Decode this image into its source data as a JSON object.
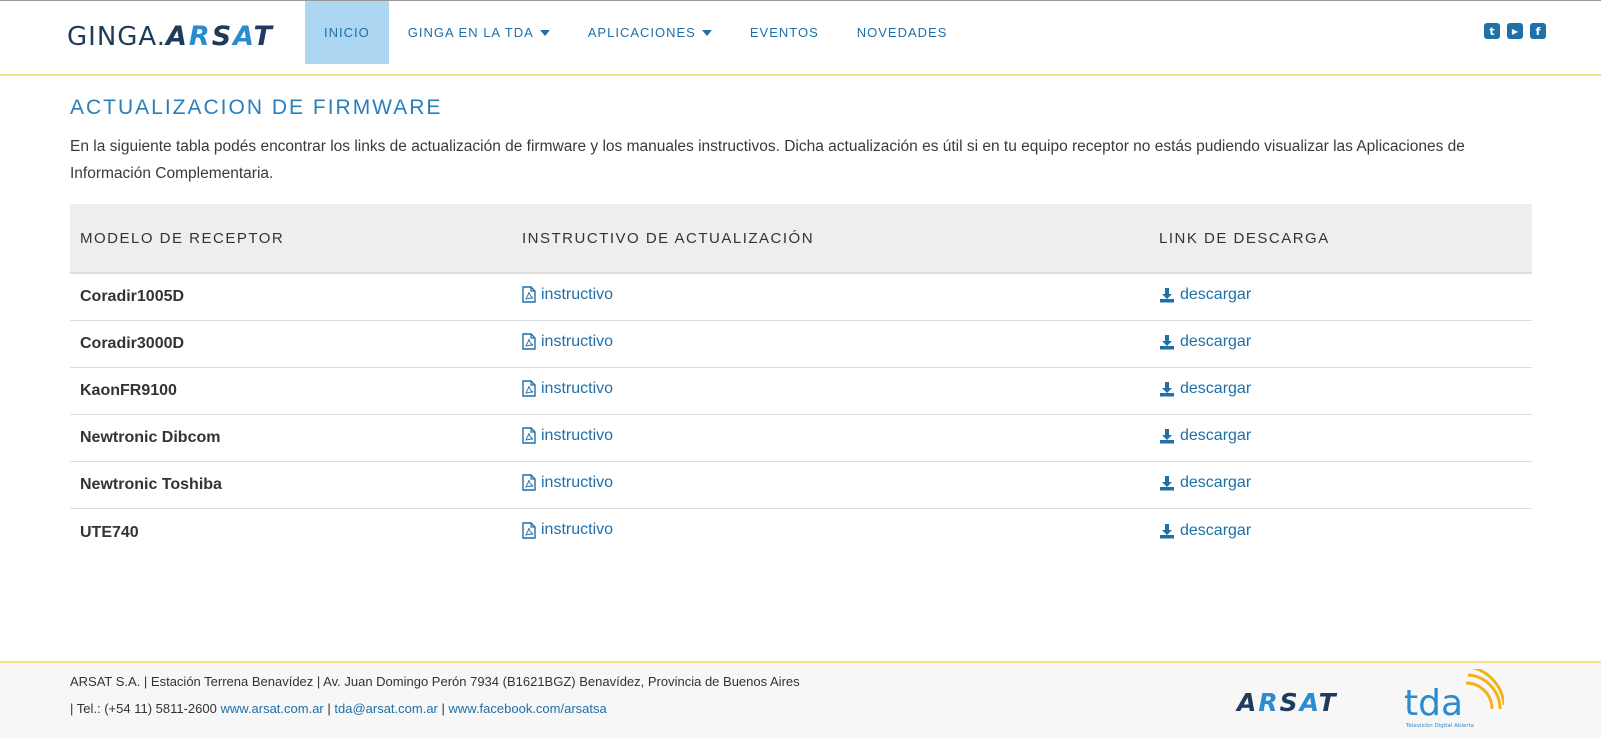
{
  "header": {
    "logo_left": "GINGA.",
    "logo_right": "ARSAT",
    "nav": [
      {
        "label": "INICIO",
        "active": true,
        "dropdown": false
      },
      {
        "label": "GINGA EN LA TDA",
        "active": false,
        "dropdown": true
      },
      {
        "label": "APLICACIONES",
        "active": false,
        "dropdown": true
      },
      {
        "label": "EVENTOS",
        "active": false,
        "dropdown": false
      },
      {
        "label": "NOVEDADES",
        "active": false,
        "dropdown": false
      }
    ],
    "social": [
      {
        "name": "twitter-icon",
        "glyph": "t"
      },
      {
        "name": "youtube-icon",
        "glyph": "▶"
      },
      {
        "name": "facebook-icon",
        "glyph": "f"
      }
    ]
  },
  "main": {
    "title": "ACTUALIZACION DE FIRMWARE",
    "intro": "En la siguiente tabla podés encontrar los links de actualización de firmware y los manuales instructivos. Dicha actualización es útil si en tu equipo receptor no estás pudiendo visualizar las Aplicaciones de Información Complementaria.",
    "table": {
      "headers": [
        "MODELO DE RECEPTOR",
        "INSTRUCTIVO DE ACTUALIZACIÓN",
        "LINK DE DESCARGA"
      ],
      "rows": [
        {
          "model": "Coradir1005D",
          "manual": "instructivo",
          "download": "descargar"
        },
        {
          "model": "Coradir3000D",
          "manual": "instructivo",
          "download": "descargar"
        },
        {
          "model": "KaonFR9100",
          "manual": "instructivo",
          "download": "descargar"
        },
        {
          "model": "Newtronic Dibcom",
          "manual": "instructivo",
          "download": "descargar"
        },
        {
          "model": "Newtronic Toshiba",
          "manual": "instructivo",
          "download": "descargar"
        },
        {
          "model": "UTE740",
          "manual": "instructivo",
          "download": "descargar"
        }
      ]
    }
  },
  "footer": {
    "line1": "ARSAT S.A. | Estación Terrena Benavídez | Av. Juan Domingo Perón 7934 (B1621BGZ) Benavídez, Provincia de Buenos Aires",
    "line2_prefix": "| Tel.: (+54 11) 5811-2600 ",
    "link_web": "www.arsat.com.ar",
    "sep1": " | ",
    "link_email": "tda@arsat.com.ar",
    "sep2": " | ",
    "link_facebook": "www.facebook.com/arsatsa",
    "logo_arsat": "ARSAT",
    "logo_tda": "tda",
    "logo_tda_caption": "Televisión Digital Abierta"
  },
  "colors": {
    "accent": "#1f6fa8",
    "title": "#2a7fba",
    "nav_active_bg": "#acd6f1",
    "header_border": "#efe38a",
    "table_header_bg": "#eeeeee",
    "tda_orange": "#f2b31a"
  }
}
